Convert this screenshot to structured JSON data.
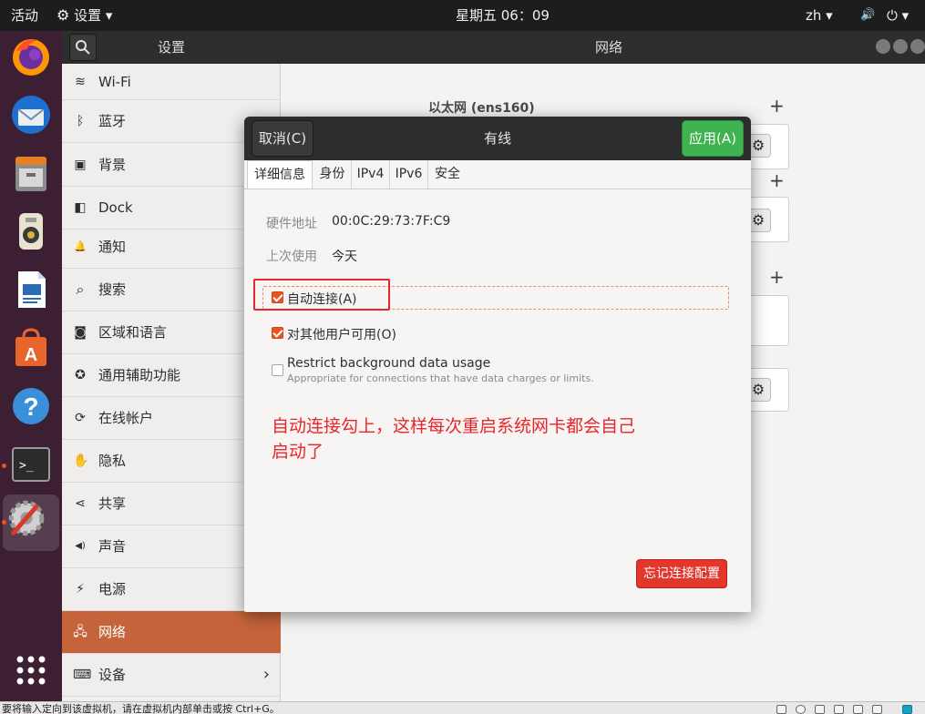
{
  "topbar": {
    "activities": "活动",
    "app_menu": "设置 ▾",
    "clock": "星期五 06：09",
    "input_method": "zh ▾",
    "sound": "🔊",
    "power": "⏻ ▾"
  },
  "dock": {
    "apps": [
      "firefox-icon",
      "thunderbird-icon",
      "files-icon",
      "rhythmbox-icon",
      "writer-icon",
      "software-icon",
      "help-icon",
      "terminal-icon",
      "settings-icon"
    ],
    "help_glyph": "?",
    "terminal_glyph": ">_"
  },
  "sidebar": {
    "title": "设置",
    "items": [
      {
        "label": "Wi-Fi",
        "icon": "wifi-icon",
        "glyph": "≋"
      },
      {
        "label": "蓝牙",
        "icon": "bluetooth-icon",
        "glyph": "ᛒ"
      },
      {
        "label": "背景",
        "icon": "background-icon",
        "glyph": "▣"
      },
      {
        "label": "Dock",
        "icon": "dock-icon",
        "glyph": "◧"
      },
      {
        "label": "通知",
        "icon": "bell-icon",
        "glyph": "🔔"
      },
      {
        "label": "搜索",
        "icon": "search-icon",
        "glyph": "⌕"
      },
      {
        "label": "区域和语言",
        "icon": "camera-icon",
        "glyph": "◙"
      },
      {
        "label": "通用辅助功能",
        "icon": "accessibility-icon",
        "glyph": "✪"
      },
      {
        "label": "在线帐户",
        "icon": "online-accounts-icon",
        "glyph": "⟳"
      },
      {
        "label": "隐私",
        "icon": "hand-icon",
        "glyph": "✋"
      },
      {
        "label": "共享",
        "icon": "share-icon",
        "glyph": "⋖"
      },
      {
        "label": "声音",
        "icon": "speaker-icon",
        "glyph": "◀)"
      },
      {
        "label": "电源",
        "icon": "power-plug-icon",
        "glyph": "⚡"
      },
      {
        "label": "网络",
        "icon": "network-icon",
        "glyph": "🖧"
      },
      {
        "label": "设备",
        "icon": "devices-icon",
        "glyph": "⌨",
        "chevron": "›"
      }
    ],
    "selected": "网络"
  },
  "main": {
    "title": "网络",
    "ethernet_heading": "以太网 (ens160)",
    "plus": "+",
    "gear": "⚙"
  },
  "dialog": {
    "cancel_label": "取消(C)",
    "title": "有线",
    "apply_label": "应用(A)",
    "tabs": [
      "详细信息",
      "身份",
      "IPv4",
      "IPv6",
      "安全"
    ],
    "selected_tab": "详细信息",
    "hardware_label": "硬件地址",
    "hardware_value": "00:0C:29:73:7F:C9",
    "last_used_label": "上次使用",
    "last_used_value": "今天",
    "auto_connect_label": "自动连接(A)",
    "auto_connect_checked": true,
    "all_users_label": "对其他用户可用(O)",
    "all_users_checked": true,
    "restrict_label": "Restrict background data usage",
    "restrict_sub": "Appropriate for connections that have data charges or limits.",
    "restrict_checked": false,
    "annotation_line1": "自动连接勾上，这样每次重启系统网卡都会自己",
    "annotation_line2": "启动了",
    "forget_label": "忘记连接配置"
  },
  "colors": {
    "accent": "#e95420",
    "selected_sidebar": "#c5643a",
    "apply_green": "#3eb34f",
    "forget_red": "#e3362d",
    "annotation_red": "#e8262b",
    "dock_bg": "#3c1f33"
  },
  "statusbar": {
    "message": "要将输入定向到该虚拟机，请在虚拟机内部单击或按 Ctrl+G。"
  }
}
